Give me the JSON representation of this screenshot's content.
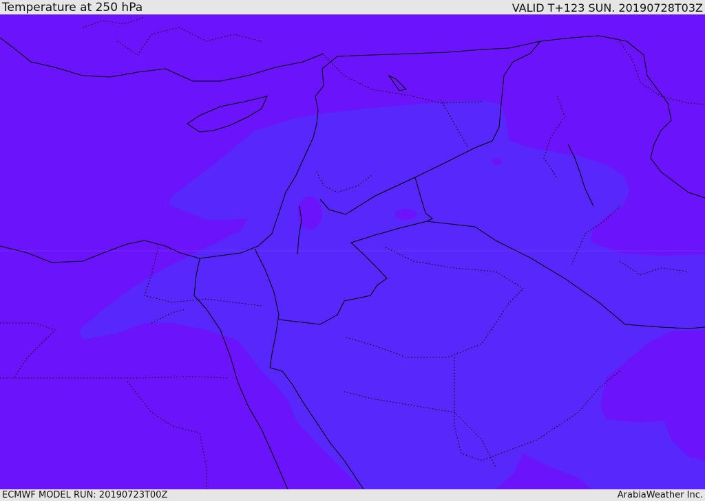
{
  "header": {
    "title": "Temperature at 250 hPa",
    "valid_time": "VALID T+123 SUN. 20190728T03Z"
  },
  "footer": {
    "model_run": "ECMWF MODEL RUN: 20190723T00Z",
    "credit": "ArabiaWeather Inc."
  },
  "map": {
    "field": "temperature",
    "level": "250 hPa",
    "colors": {
      "cooler_shade": "#6b14fb",
      "warmer_shade": "#5727fb",
      "boundaries": "#000000"
    }
  }
}
